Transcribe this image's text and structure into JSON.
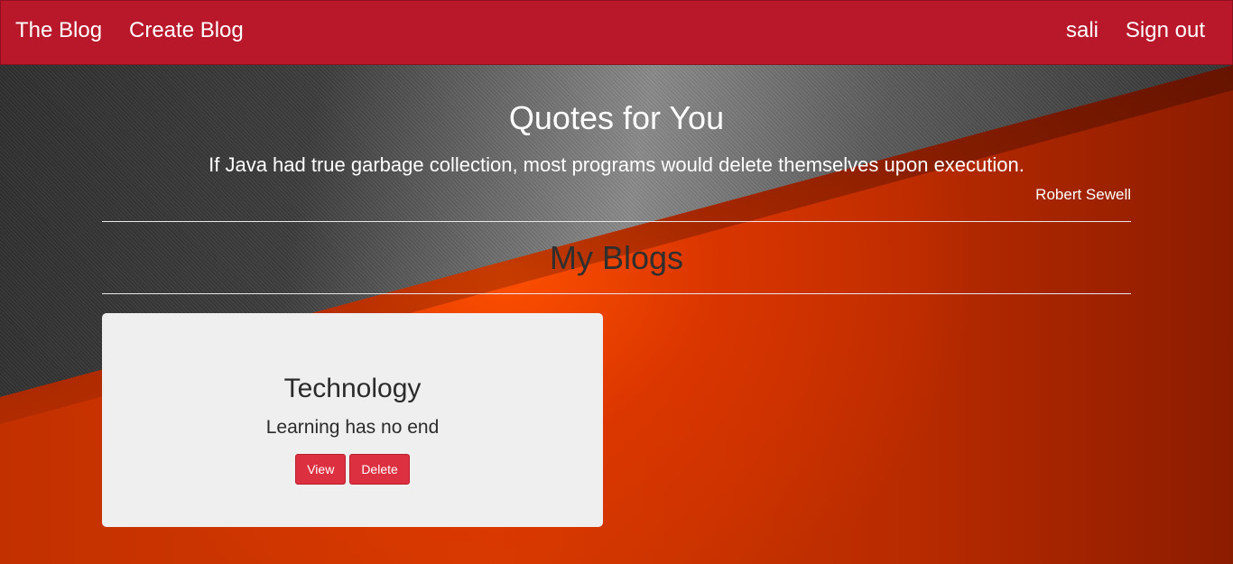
{
  "navbar": {
    "brand": "The Blog",
    "create_link": "Create Blog",
    "user": "sali",
    "sign_out": "Sign out",
    "color": "#b9182b"
  },
  "quotes": {
    "title": "Quotes for You",
    "text": "If Java had true garbage collection, most programs would delete themselves upon execution.",
    "author": "Robert Sewell"
  },
  "blogs": {
    "title": "My Blogs",
    "items": [
      {
        "title": "Technology",
        "description": "Learning has no end",
        "view_label": "View",
        "delete_label": "Delete"
      }
    ]
  },
  "colors": {
    "accent_button": "#dc3040",
    "card_background": "#efefef"
  }
}
